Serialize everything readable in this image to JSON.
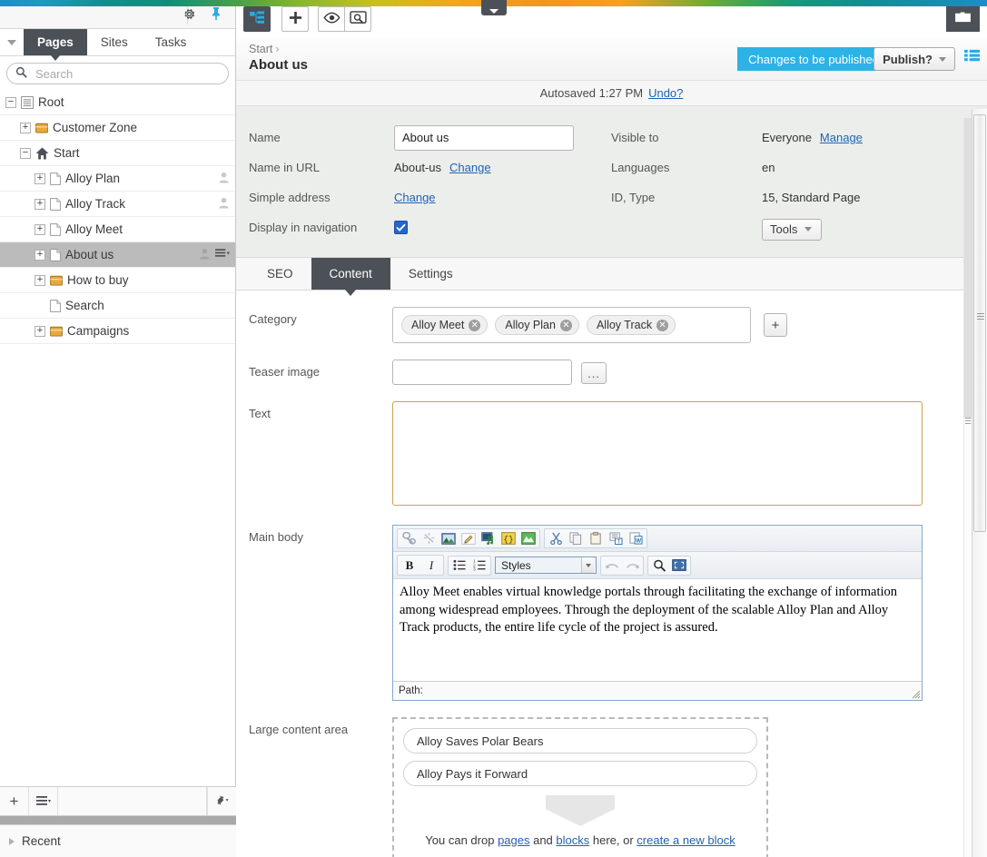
{
  "sidebar": {
    "gear_icon": "gear-icon",
    "pin_icon": "pin-icon",
    "collapse_icon": "chevron-down-icon",
    "tabs": [
      {
        "label": "Pages",
        "active": true
      },
      {
        "label": "Sites",
        "active": false
      },
      {
        "label": "Tasks",
        "active": false
      }
    ],
    "search": {
      "placeholder": "Search",
      "value": "",
      "icon": "search-icon"
    },
    "tree": [
      {
        "label": "Root",
        "indent": 0,
        "toggle": "minus",
        "icon": "root-icon",
        "selected": false,
        "person": false,
        "menu": false
      },
      {
        "label": "Customer Zone",
        "indent": 1,
        "toggle": "plus",
        "icon": "folder-icon",
        "selected": false,
        "person": false,
        "menu": false
      },
      {
        "label": "Start",
        "indent": 1,
        "toggle": "minus",
        "icon": "home-icon",
        "selected": false,
        "person": false,
        "menu": false
      },
      {
        "label": "Alloy Plan",
        "indent": 2,
        "toggle": "plus",
        "icon": "doc-icon",
        "selected": false,
        "person": true,
        "menu": false
      },
      {
        "label": "Alloy Track",
        "indent": 2,
        "toggle": "plus",
        "icon": "doc-icon",
        "selected": false,
        "person": true,
        "menu": false
      },
      {
        "label": "Alloy Meet",
        "indent": 2,
        "toggle": "plus",
        "icon": "doc-icon",
        "selected": false,
        "person": false,
        "menu": false
      },
      {
        "label": "About us",
        "indent": 2,
        "toggle": "plus",
        "icon": "doc-icon",
        "selected": true,
        "person": true,
        "menu": true
      },
      {
        "label": "How to buy",
        "indent": 2,
        "toggle": "plus",
        "icon": "folder-icon",
        "selected": false,
        "person": false,
        "menu": false
      },
      {
        "label": "Search",
        "indent": 2,
        "toggle": "none",
        "icon": "doc-icon",
        "selected": false,
        "person": false,
        "menu": false
      },
      {
        "label": "Campaigns",
        "indent": 2,
        "toggle": "plus",
        "icon": "folder-icon",
        "selected": false,
        "person": false,
        "menu": false
      }
    ],
    "footer": {
      "add_label": "+",
      "menu_icon": "hamburger-menu-icon",
      "settings_icon": "gear-icon",
      "recent_label": "Recent"
    }
  },
  "main": {
    "toolbar": {
      "sitetree_icon": "site-tree-icon",
      "add_icon": "plus-icon",
      "preview_icon": "eye-icon",
      "inspect_icon": "preview-search-icon",
      "folder_icon": "folder-icon"
    },
    "header": {
      "breadcrumb_parent": "Start",
      "breadcrumb_sep": "›",
      "title": "About us",
      "publish_ribbon": "Changes to be published",
      "publish_button": "Publish?",
      "list_icon": "list-icon",
      "accent_color": "#2cb3e5"
    },
    "autosave": {
      "text": "Autosaved 1:27 PM",
      "undo_label": "Undo?"
    },
    "properties": {
      "left": [
        {
          "label": "Name",
          "type": "input",
          "value": "About us"
        },
        {
          "label": "Name in URL",
          "type": "text-link",
          "value": "About-us",
          "link": "Change"
        },
        {
          "label": "Simple address",
          "type": "link",
          "value": "",
          "link": "Change"
        },
        {
          "label": "Display in navigation",
          "type": "checkbox",
          "checked": true
        }
      ],
      "right": [
        {
          "label": "Visible to",
          "type": "text-link",
          "value": "Everyone",
          "link": "Manage"
        },
        {
          "label": "Languages",
          "type": "text",
          "value": "en"
        },
        {
          "label": "ID, Type",
          "type": "text",
          "value": "15, Standard Page"
        }
      ],
      "tools_button": "Tools"
    },
    "content_tabs": [
      {
        "label": "SEO",
        "active": false
      },
      {
        "label": "Content",
        "active": true
      },
      {
        "label": "Settings",
        "active": false
      }
    ],
    "form": {
      "category": {
        "label": "Category",
        "chips": [
          "Alloy Meet",
          "Alloy Plan",
          "Alloy Track"
        ],
        "add_label": "+"
      },
      "teaser_image": {
        "label": "Teaser image",
        "value": "",
        "browse_label": "..."
      },
      "text": {
        "label": "Text",
        "value": ""
      },
      "main_body": {
        "label": "Main body",
        "toolbar_group_1": [
          "link-icon",
          "unlink-icon",
          "image-icon",
          "edit-image-icon",
          "media-icon",
          "source-code-icon",
          "flash-icon"
        ],
        "toolbar_group_2": [
          "cut-icon",
          "copy-icon",
          "paste-icon",
          "paste-text-icon",
          "paste-word-icon"
        ],
        "bold_label": "B",
        "italic_label": "I",
        "bullet_list_icon": "bullet-list-icon",
        "numbered_list_icon": "numbered-list-icon",
        "styles_label": "Styles",
        "undo_icon": "undo-icon",
        "redo_icon": "redo-icon",
        "find_icon": "search-icon",
        "fullscreen_icon": "maximize-icon",
        "body_text": "Alloy Meet enables virtual knowledge portals through facilitating the exchange of information among widespread employees. Through the deployment of the scalable Alloy Plan and Alloy Track products, the entire life cycle of the project is assured.",
        "path_label": "Path:"
      },
      "large_content_area": {
        "label": "Large content area",
        "blocks": [
          "Alloy Saves Polar Bears",
          "Alloy Pays it Forward"
        ],
        "hint_prefix": "You can drop ",
        "hint_link1": "pages",
        "hint_mid": " and ",
        "hint_link2": "blocks",
        "hint_suffix": " here, or ",
        "hint_link3": "create a new block"
      }
    }
  }
}
